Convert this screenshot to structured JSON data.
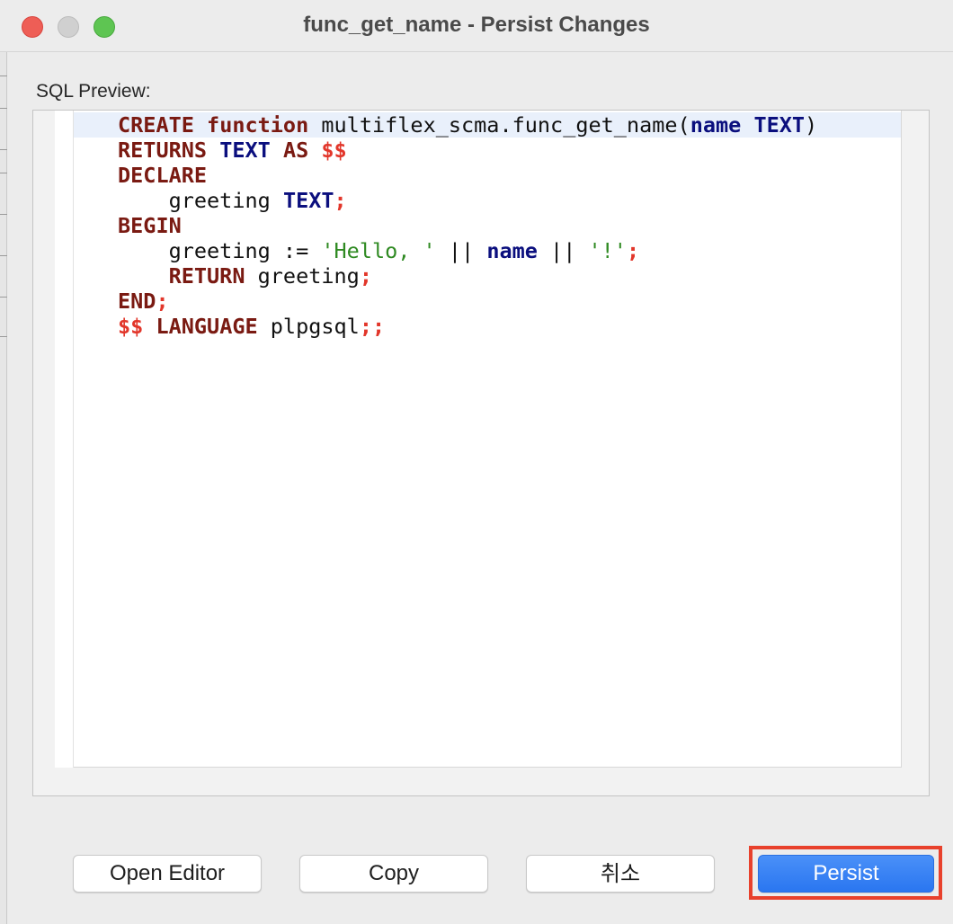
{
  "window": {
    "title": "func_get_name - Persist Changes"
  },
  "traffic_lights": {
    "close": "close-window",
    "minimize": "minimize-window",
    "zoom": "zoom-window"
  },
  "sql_preview": {
    "label": "SQL Preview:",
    "lines": [
      [
        {
          "t": "CREATE",
          "c": "kw"
        },
        {
          "t": " ",
          "c": "plain"
        },
        {
          "t": "function",
          "c": "kw"
        },
        {
          "t": " multiflex_scma.func_get_name(",
          "c": "plain"
        },
        {
          "t": "name",
          "c": "ty"
        },
        {
          "t": " ",
          "c": "plain"
        },
        {
          "t": "TEXT",
          "c": "ty"
        },
        {
          "t": ")",
          "c": "plain"
        }
      ],
      [
        {
          "t": "RETURNS",
          "c": "kw"
        },
        {
          "t": " ",
          "c": "plain"
        },
        {
          "t": "TEXT",
          "c": "ty"
        },
        {
          "t": " ",
          "c": "plain"
        },
        {
          "t": "AS",
          "c": "kw"
        },
        {
          "t": " ",
          "c": "plain"
        },
        {
          "t": "$$",
          "c": "op"
        }
      ],
      [
        {
          "t": "DECLARE",
          "c": "kw"
        }
      ],
      [
        {
          "t": "    greeting ",
          "c": "plain"
        },
        {
          "t": "TEXT",
          "c": "ty"
        },
        {
          "t": ";",
          "c": "op"
        }
      ],
      [
        {
          "t": "BEGIN",
          "c": "kw"
        }
      ],
      [
        {
          "t": "    greeting := ",
          "c": "plain"
        },
        {
          "t": "'Hello, '",
          "c": "str"
        },
        {
          "t": " || ",
          "c": "plain"
        },
        {
          "t": "name",
          "c": "ty"
        },
        {
          "t": " || ",
          "c": "plain"
        },
        {
          "t": "'!'",
          "c": "str"
        },
        {
          "t": ";",
          "c": "op"
        }
      ],
      [
        {
          "t": "    ",
          "c": "plain"
        },
        {
          "t": "RETURN",
          "c": "kw"
        },
        {
          "t": " greeting",
          "c": "plain"
        },
        {
          "t": ";",
          "c": "op"
        }
      ],
      [
        {
          "t": "END",
          "c": "kw"
        },
        {
          "t": ";",
          "c": "op"
        }
      ],
      [
        {
          "t": "$$",
          "c": "op"
        },
        {
          "t": " ",
          "c": "plain"
        },
        {
          "t": "LANGUAGE",
          "c": "kw"
        },
        {
          "t": " plpgsql",
          "c": "plain"
        },
        {
          "t": ";;",
          "c": "op"
        }
      ]
    ]
  },
  "buttons": {
    "open_editor": "Open Editor",
    "copy": "Copy",
    "cancel": "취소",
    "persist": "Persist"
  },
  "colors": {
    "keyword": "#7a1a12",
    "type": "#0b0f7e",
    "operator": "#e2362a",
    "string": "#2f8a22",
    "primary_button": "#2f7cf6",
    "highlight_outline": "#e8412c"
  }
}
